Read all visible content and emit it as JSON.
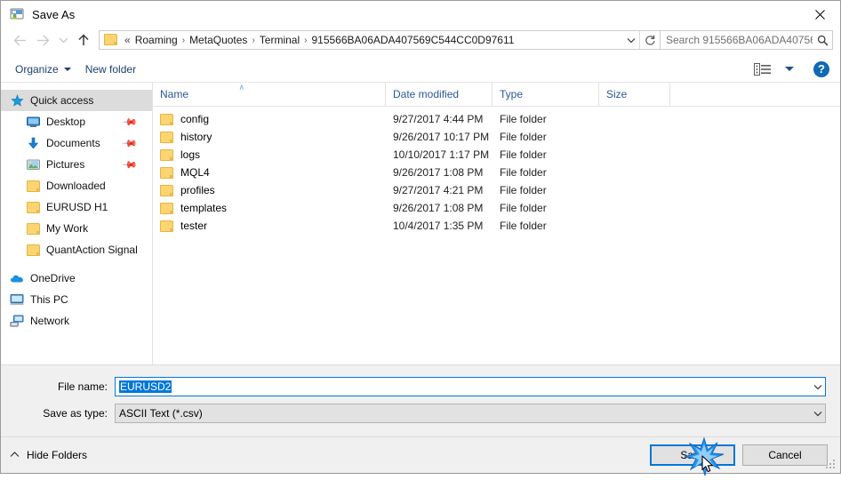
{
  "window": {
    "title": "Save As",
    "icon": "save-as-icon",
    "close_label": "✕"
  },
  "nav": {
    "back": "←",
    "forward": "→",
    "recent": "⌄",
    "up": "↑",
    "refresh": "↻",
    "dropdown": "⌄"
  },
  "address": {
    "ellipsis": "«",
    "separator": "›",
    "crumbs": [
      "Roaming",
      "MetaQuotes",
      "Terminal",
      "915566BA06ADA407569C544CC0D97611"
    ]
  },
  "search": {
    "placeholder": "Search 915566BA06ADA40756...",
    "icon": "search-icon"
  },
  "toolbar": {
    "organize_label": "Organize",
    "new_folder_label": "New folder",
    "view_icon": "list-view-icon",
    "help_label": "?"
  },
  "sidebar": {
    "items": [
      {
        "label": "Quick access",
        "icon": "star-icon",
        "level": "group",
        "selected": true,
        "pinned": false
      },
      {
        "label": "Desktop",
        "icon": "desktop-icon",
        "level": "indent",
        "selected": false,
        "pinned": true
      },
      {
        "label": "Documents",
        "icon": "download-icon",
        "level": "indent",
        "selected": false,
        "pinned": true
      },
      {
        "label": "Pictures",
        "icon": "pictures-icon",
        "level": "indent",
        "selected": false,
        "pinned": true
      },
      {
        "label": "Downloaded",
        "icon": "folder-icon",
        "level": "indent",
        "selected": false,
        "pinned": false
      },
      {
        "label": "EURUSD H1",
        "icon": "folder-icon",
        "level": "indent",
        "selected": false,
        "pinned": false
      },
      {
        "label": "My Work",
        "icon": "folder-icon",
        "level": "indent",
        "selected": false,
        "pinned": false
      },
      {
        "label": "QuantAction Signal",
        "icon": "folder-icon",
        "level": "indent",
        "selected": false,
        "pinned": false
      },
      {
        "label": "OneDrive",
        "icon": "onedrive-icon",
        "level": "group",
        "selected": false,
        "pinned": false
      },
      {
        "label": "This PC",
        "icon": "thispc-icon",
        "level": "group",
        "selected": false,
        "pinned": false
      },
      {
        "label": "Network",
        "icon": "network-icon",
        "level": "group",
        "selected": false,
        "pinned": false
      }
    ]
  },
  "filelist": {
    "columns": [
      "Name",
      "Date modified",
      "Type",
      "Size"
    ],
    "sort_column": "Name",
    "sort_caret": "∧",
    "rows": [
      {
        "name": "config",
        "date": "9/27/2017 4:44 PM",
        "type": "File folder",
        "size": ""
      },
      {
        "name": "history",
        "date": "9/26/2017 10:17 PM",
        "type": "File folder",
        "size": ""
      },
      {
        "name": "logs",
        "date": "10/10/2017 1:17 PM",
        "type": "File folder",
        "size": ""
      },
      {
        "name": "MQL4",
        "date": "9/26/2017 1:08 PM",
        "type": "File folder",
        "size": ""
      },
      {
        "name": "profiles",
        "date": "9/27/2017 4:21 PM",
        "type": "File folder",
        "size": ""
      },
      {
        "name": "templates",
        "date": "9/26/2017 1:08 PM",
        "type": "File folder",
        "size": ""
      },
      {
        "name": "tester",
        "date": "10/4/2017 1:35 PM",
        "type": "File folder",
        "size": ""
      }
    ]
  },
  "form": {
    "filename_label": "File name:",
    "filename_value": "EURUSD2",
    "filetype_label": "Save as type:",
    "filetype_value": "ASCII Text (*.csv)",
    "arrow": "⌄"
  },
  "footer": {
    "hide_folders_label": "Hide Folders",
    "hide_folders_caret": "∧",
    "save_label": "Save",
    "cancel_label": "Cancel"
  },
  "colors": {
    "accent": "#0078d7",
    "header_text": "#2b5797",
    "toolbar_text": "#1b3f6e",
    "folder": "#fbd572",
    "selection": "#dcdcdc"
  }
}
